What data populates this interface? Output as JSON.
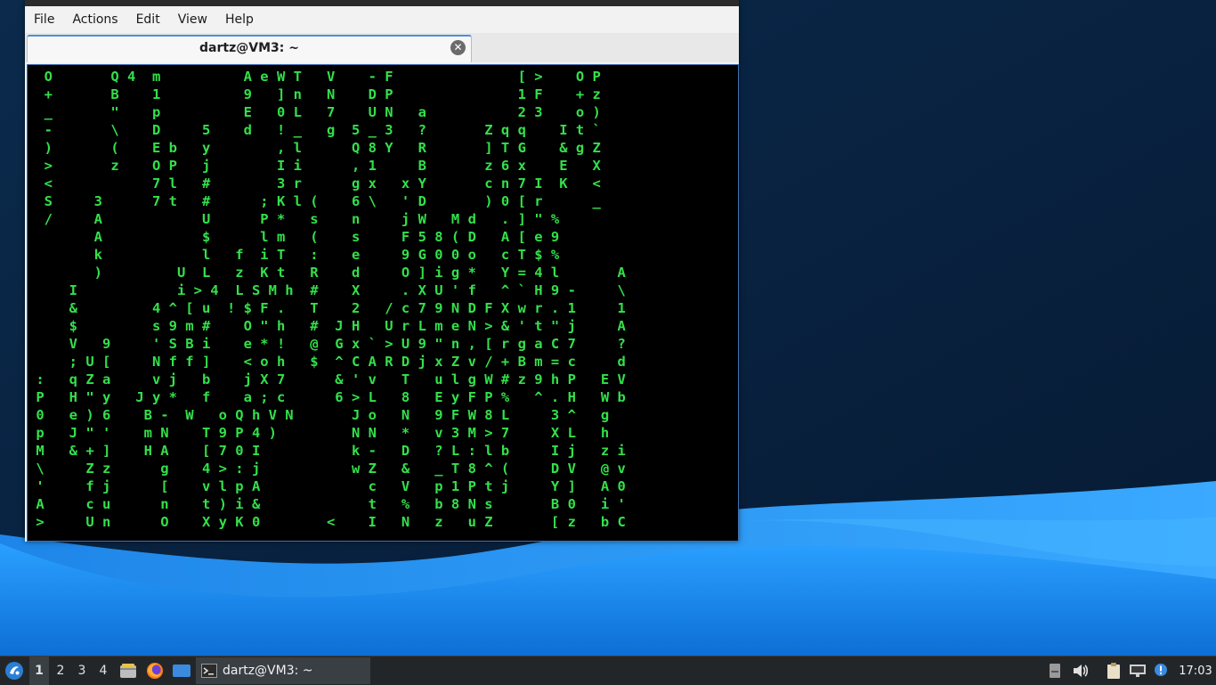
{
  "window": {
    "menu": [
      "File",
      "Actions",
      "Edit",
      "View",
      "Help"
    ],
    "tab_title": "dartz@VM3: ~",
    "tab_close_glyph": "✕"
  },
  "terminal": {
    "lines": [
      "  O       Q 4  m          A e W T   V    - F               [ >    O P",
      "  +       B    1          9   ] n   N    D P               1 F    + z",
      "  _       \"    p          E   0 L   7    U N   a           2 3    o )",
      "  -       \\    D     5    d   ! _   g  5 _ 3   ?       Z q q    I t `",
      "  )       (    E b   y        , l      Q 8 Y   R       ] T G    & g Z",
      "  >       z    O P   j        I i      , 1     B       z 6 x    E   X",
      "  <            7 l   #        3 r      g x   x Y       c n 7 I  K   <",
      "  S     3      7 t   #      ; K l (    6 \\   ' D       ) 0 [ r      _",
      "  /     A            U      P *   s    n     j W   M d   . ] \" %",
      "        A            $      l m   (    s     F 5 8 ( D   A [ e 9",
      "        k            l   f  i T   :    e     9 G 0 0 o   c T $ %",
      "        )         U  L   z  K t   R    d     O ] i g *   Y = 4 l       A",
      "     I            i > 4  L S M h  #    X     . X U ' f   ^ ` H 9 -     \\",
      "     &         4 ^ [ u  ! $ F .   T    2   / c 7 9 N D F X w r . 1     1",
      "     $         s 9 m #    O \" h   #  J H   U r L m e N > & ' t \" j     A",
      "     V   9     ' S B i    e * !   @  G x ` > U 9 \" n , [ r g a C 7     ?",
      "     ; U [     N f f ]    < o h   $  ^ C A R D j x Z v / + B m = c     d",
      " :   q Z a     v j   b    j X 7      & ' v   T   u l g W # z 9 h P   E V",
      " P   H \" y   J y *   f    a ; c      6 > L   8   E y F P %   ^ . H   W b",
      " 0   e ) 6    B -  W   o Q h V N       J o   N   9 F W 8 L     3 ^   g",
      " p   J \" '    m N    T 9 P 4 )         N N   *   v 3 M > 7     X L   h",
      " M   & + ]    H A    [ 7 0 I           k -   D   ? L : l b     I j   z i",
      " \\     Z z      g    4 > : j           w Z   &   _ T 8 ^ (     D V   @ v",
      " '     f j      [    v l p A             c   V   p 1 P t j     Y ]   A 0",
      " A     c u      n    t ) i &             t   %   b 8 N s       B 0   i '",
      " >     U n      O    X y K 0        <    I   N   z   u Z       [ z   b C"
    ]
  },
  "taskbar": {
    "workspaces": [
      "1",
      "2",
      "3",
      "4"
    ],
    "task_label": "dartz@VM3: ~",
    "clock": "17:03"
  },
  "colors": {
    "matrix_green": "#33e04a",
    "desktop_dark": "#0a2444",
    "wave_blue": "#1c8ef0",
    "taskbar": "#232629"
  }
}
